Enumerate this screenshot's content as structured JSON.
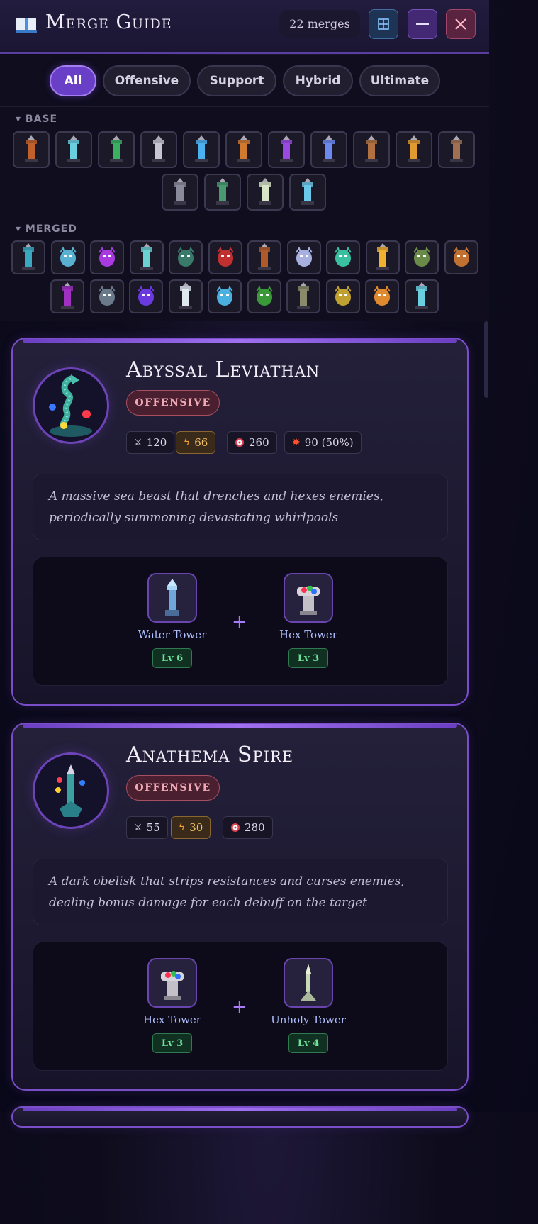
{
  "header": {
    "title": "Merge Guide",
    "merge_count": "22 merges"
  },
  "filters": [
    {
      "label": "All",
      "active": true
    },
    {
      "label": "Offensive",
      "active": false
    },
    {
      "label": "Support",
      "active": false
    },
    {
      "label": "Hybrid",
      "active": false
    },
    {
      "label": "Ultimate",
      "active": false
    }
  ],
  "sections": {
    "base_label": "BASE",
    "merged_label": "MERGED"
  },
  "colors": {
    "accent": "#7a4ec9",
    "offensive": "#f0a8b4",
    "level": "#6ee09a",
    "energy": "#f2c064"
  },
  "cards": [
    {
      "name": "Abyssal Leviathan",
      "type": "OFFENSIVE",
      "stats": {
        "damage": "120",
        "energy": "66",
        "range": "260",
        "splash": "90 (50%)"
      },
      "description": "A massive sea beast that drenches and hexes enemies, periodically summoning devastating whirlpools",
      "ingredients": [
        {
          "name": "Water Tower",
          "level": "Lv 6"
        },
        {
          "name": "Hex Tower",
          "level": "Lv 3"
        }
      ]
    },
    {
      "name": "Anathema Spire",
      "type": "OFFENSIVE",
      "stats": {
        "damage": "55",
        "energy": "30",
        "range": "280"
      },
      "description": "A dark obelisk that strips resistances and curses enemies, dealing bonus damage for each debuff on the target",
      "ingredients": [
        {
          "name": "Hex Tower",
          "level": "Lv 3"
        },
        {
          "name": "Unholy Tower",
          "level": "Lv 4"
        }
      ]
    }
  ]
}
